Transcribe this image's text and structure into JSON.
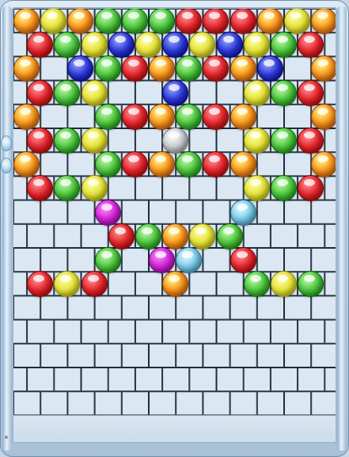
{
  "palette": {
    "orange": "#f7941d",
    "yellow": "#e6e33a",
    "green": "#4fc43f",
    "red": "#e3262c",
    "blue": "#2b39d6",
    "magenta": "#d024d6",
    "light_blue": "#7ccbea",
    "silver": "#c8ccd0",
    "brick_face": "#dbe7f2",
    "brick_line": "#1f2b36"
  },
  "grid": {
    "columns": 12,
    "rows_with_bubbles": 12
  },
  "bubble_rows": [
    {
      "row": 0,
      "offset": false,
      "bubbles": [
        "orange",
        "yellow",
        "orange",
        "green",
        "green",
        "green",
        "red",
        "red",
        "red",
        "orange",
        "yellow",
        "orange"
      ]
    },
    {
      "row": 1,
      "offset": true,
      "bubbles": [
        "red",
        "green",
        "yellow",
        "blue",
        "yellow",
        "blue",
        "yellow",
        "blue",
        "yellow",
        "green",
        "red"
      ]
    },
    {
      "row": 2,
      "offset": false,
      "bubbles": [
        "orange",
        null,
        "blue",
        "green",
        "red",
        "orange",
        "green",
        "red",
        "orange",
        "blue",
        null,
        "orange"
      ]
    },
    {
      "row": 3,
      "offset": true,
      "bubbles": [
        "red",
        "green",
        "yellow",
        null,
        null,
        "blue",
        null,
        null,
        "yellow",
        "green",
        "red"
      ]
    },
    {
      "row": 4,
      "offset": false,
      "bubbles": [
        "orange",
        null,
        null,
        "green",
        "red",
        "orange",
        "green",
        "red",
        "orange",
        null,
        null,
        "orange"
      ]
    },
    {
      "row": 5,
      "offset": true,
      "bubbles": [
        "red",
        "green",
        "yellow",
        null,
        null,
        "silver",
        null,
        null,
        "yellow",
        "green",
        "red"
      ]
    },
    {
      "row": 6,
      "offset": false,
      "bubbles": [
        "orange",
        null,
        null,
        "green",
        "red",
        "orange",
        "green",
        "red",
        "orange",
        null,
        null,
        "orange"
      ]
    },
    {
      "row": 7,
      "offset": true,
      "bubbles": [
        "red",
        "green",
        "yellow",
        null,
        null,
        null,
        null,
        null,
        "yellow",
        "green",
        "red"
      ]
    },
    {
      "row": 8,
      "offset": false,
      "bubbles": [
        null,
        null,
        null,
        "magenta",
        null,
        null,
        null,
        null,
        "light_blue",
        null,
        null,
        null
      ]
    },
    {
      "row": 9,
      "offset": true,
      "bubbles": [
        null,
        null,
        null,
        "red",
        "green",
        "orange",
        "yellow",
        "green",
        null,
        null,
        null
      ]
    },
    {
      "row": 10,
      "offset": false,
      "bubbles": [
        null,
        null,
        null,
        "green",
        null,
        "magenta",
        "light_blue",
        null,
        "red",
        null,
        null,
        null
      ]
    },
    {
      "row": 11,
      "offset": true,
      "bubbles": [
        "red",
        "yellow",
        "red",
        null,
        null,
        "orange",
        null,
        null,
        "green",
        "yellow",
        "green"
      ]
    }
  ],
  "side_bubbles": [
    "light_blue",
    "light_blue"
  ]
}
